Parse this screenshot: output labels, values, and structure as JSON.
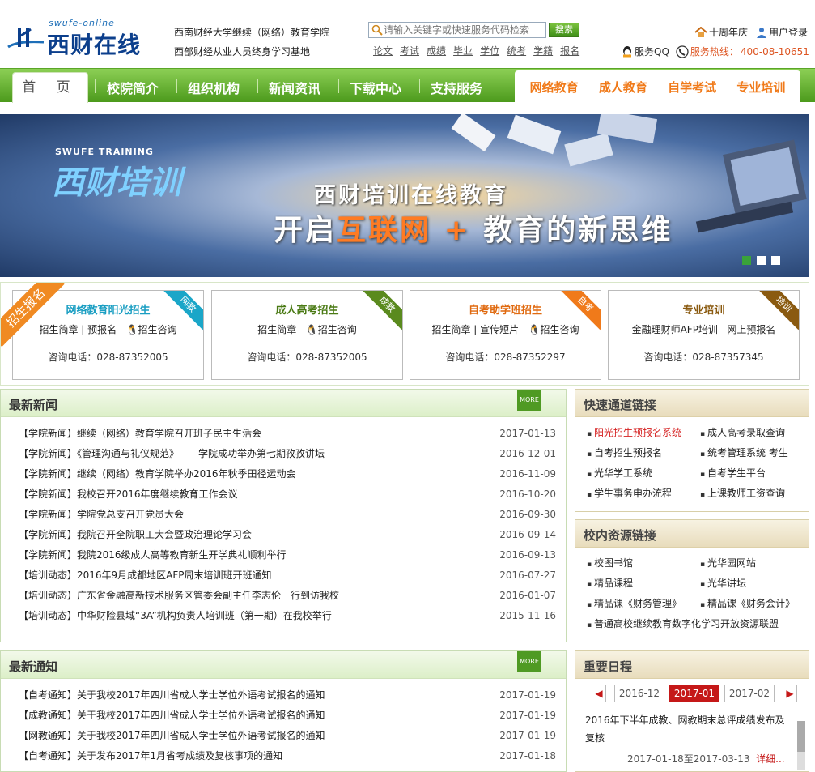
{
  "header": {
    "logo_tag": "swufe-online",
    "logo_name": "西财在线",
    "subtitle1": "西南财经大学继续（网络）教育学院",
    "subtitle2": "西部财经从业人员终身学习基地",
    "search_placeholder": "请输入关键字或快速服务代码检索",
    "search_button": "搜索",
    "quick_links": [
      "论文",
      "考试",
      "成绩",
      "毕业",
      "学位",
      "统考",
      "学籍",
      "报名"
    ],
    "anniversary": "十周年庆",
    "login": "用户登录",
    "service_qq": "服务QQ",
    "hotline_label": "服务热线：",
    "hotline": "400-08-10651"
  },
  "nav": {
    "home": "首 页",
    "items": [
      "校院简介",
      "组织机构",
      "新闻资讯",
      "下载中心",
      "支持服务"
    ],
    "right": [
      "网络教育",
      "成人教育",
      "自学考试",
      "专业培训"
    ]
  },
  "banner": {
    "brand_en": "SWUFE TRAINING",
    "brand_cn": "西财培训",
    "line1": "西财培训在线教育",
    "line2_a": "开启",
    "line2_b": "互联网",
    "line2_c": " + ",
    "line2_d": "教育的新思维"
  },
  "enrol": {
    "ribbon": "招生报名",
    "boxes": [
      {
        "title": "网络教育阳光招生",
        "links": "招生简章 | 预报名",
        "consult": "招生咨询",
        "phone": "咨询电话：028-87352005",
        "corner": "网教",
        "color": "#1aa6c8"
      },
      {
        "title": "成人高考招生",
        "links": "招生简章",
        "consult": "招生咨询",
        "phone": "咨询电话：028-87352005",
        "corner": "成教",
        "color": "#5a8a1e"
      },
      {
        "title": "自考助学班招生",
        "links": "招生简章 | 宣传短片",
        "consult": "招生咨询",
        "phone": "咨询电话：028-87352297",
        "corner": "自考",
        "color": "#f07a1a"
      },
      {
        "title": "专业培训",
        "links": "金融理财师AFP培训",
        "consult": "网上预报名",
        "phone": "咨询电话：028-87357345",
        "corner": "培训",
        "color": "#8a5a10"
      }
    ]
  },
  "news": {
    "title": "最新新闻",
    "more": "MORE",
    "items": [
      {
        "text": "【学院新闻】继续（网络）教育学院召开班子民主生活会",
        "date": "2017-01-13"
      },
      {
        "text": "【学院新闻】《管理沟通与礼仪规范》——学院成功举办第七期孜孜讲坛",
        "date": "2016-12-01"
      },
      {
        "text": "【学院新闻】继续（网络）教育学院举办2016年秋季田径运动会",
        "date": "2016-11-09"
      },
      {
        "text": "【学院新闻】我校召开2016年度继续教育工作会议",
        "date": "2016-10-20"
      },
      {
        "text": "【学院新闻】学院党总支召开党员大会",
        "date": "2016-09-30"
      },
      {
        "text": "【学院新闻】我院召开全院职工大会暨政治理论学习会",
        "date": "2016-09-14"
      },
      {
        "text": "【学院新闻】我院2016级成人高等教育新生开学典礼顺利举行",
        "date": "2016-09-13"
      },
      {
        "text": "【培训动态】2016年9月成都地区AFP周末培训班开班通知",
        "date": "2016-07-27"
      },
      {
        "text": "【培训动态】广东省金融高新技术服务区管委会副主任李志伦一行到访我校",
        "date": "2016-01-07"
      },
      {
        "text": "【培训动态】中华财险县域“3A”机构负责人培训班（第一期）在我校举行",
        "date": "2015-11-16"
      }
    ]
  },
  "notices": {
    "title": "最新通知",
    "more": "MORE",
    "items": [
      {
        "text": "【自考通知】关于我校2017年四川省成人学士学位外语考试报名的通知",
        "date": "2017-01-19"
      },
      {
        "text": "【成教通知】关于我校2017年四川省成人学士学位外语考试报名的通知",
        "date": "2017-01-19"
      },
      {
        "text": "【网教通知】关于我校2017年四川省成人学士学位外语考试报名的通知",
        "date": "2017-01-19"
      },
      {
        "text": "【自考通知】关于发布2017年1月省考成绩及复核事项的通知",
        "date": "2017-01-18"
      }
    ]
  },
  "quick": {
    "title": "快速通道链接",
    "links": [
      "阳光招生预报名系统",
      "成人高考录取查询",
      "自考招生预报名",
      "统考管理系统 考生",
      "光华学工系统",
      "自考学生平台",
      "学生事务申办流程",
      "上课教师工资查询"
    ]
  },
  "resources": {
    "title": "校内资源链接",
    "links": [
      "校图书馆",
      "光华园网站",
      "精品课程",
      "光华讲坛",
      "精品课《财务管理》",
      "精品课《财务会计》"
    ],
    "wide": "普通高校继续教育数字化学习开放资源联盟"
  },
  "schedule": {
    "title": "重要日程",
    "months": [
      "2016-12",
      "2017-01",
      "2017-02"
    ],
    "active": "2017-01",
    "event": "2016年下半年成教、网教期末总评成绩发布及复核",
    "range": "2017-01-18至2017-03-13",
    "detail": "详细..."
  },
  "colors": {
    "green": "#4c9a1c",
    "orange": "#f07a1a",
    "red": "#d52020"
  }
}
